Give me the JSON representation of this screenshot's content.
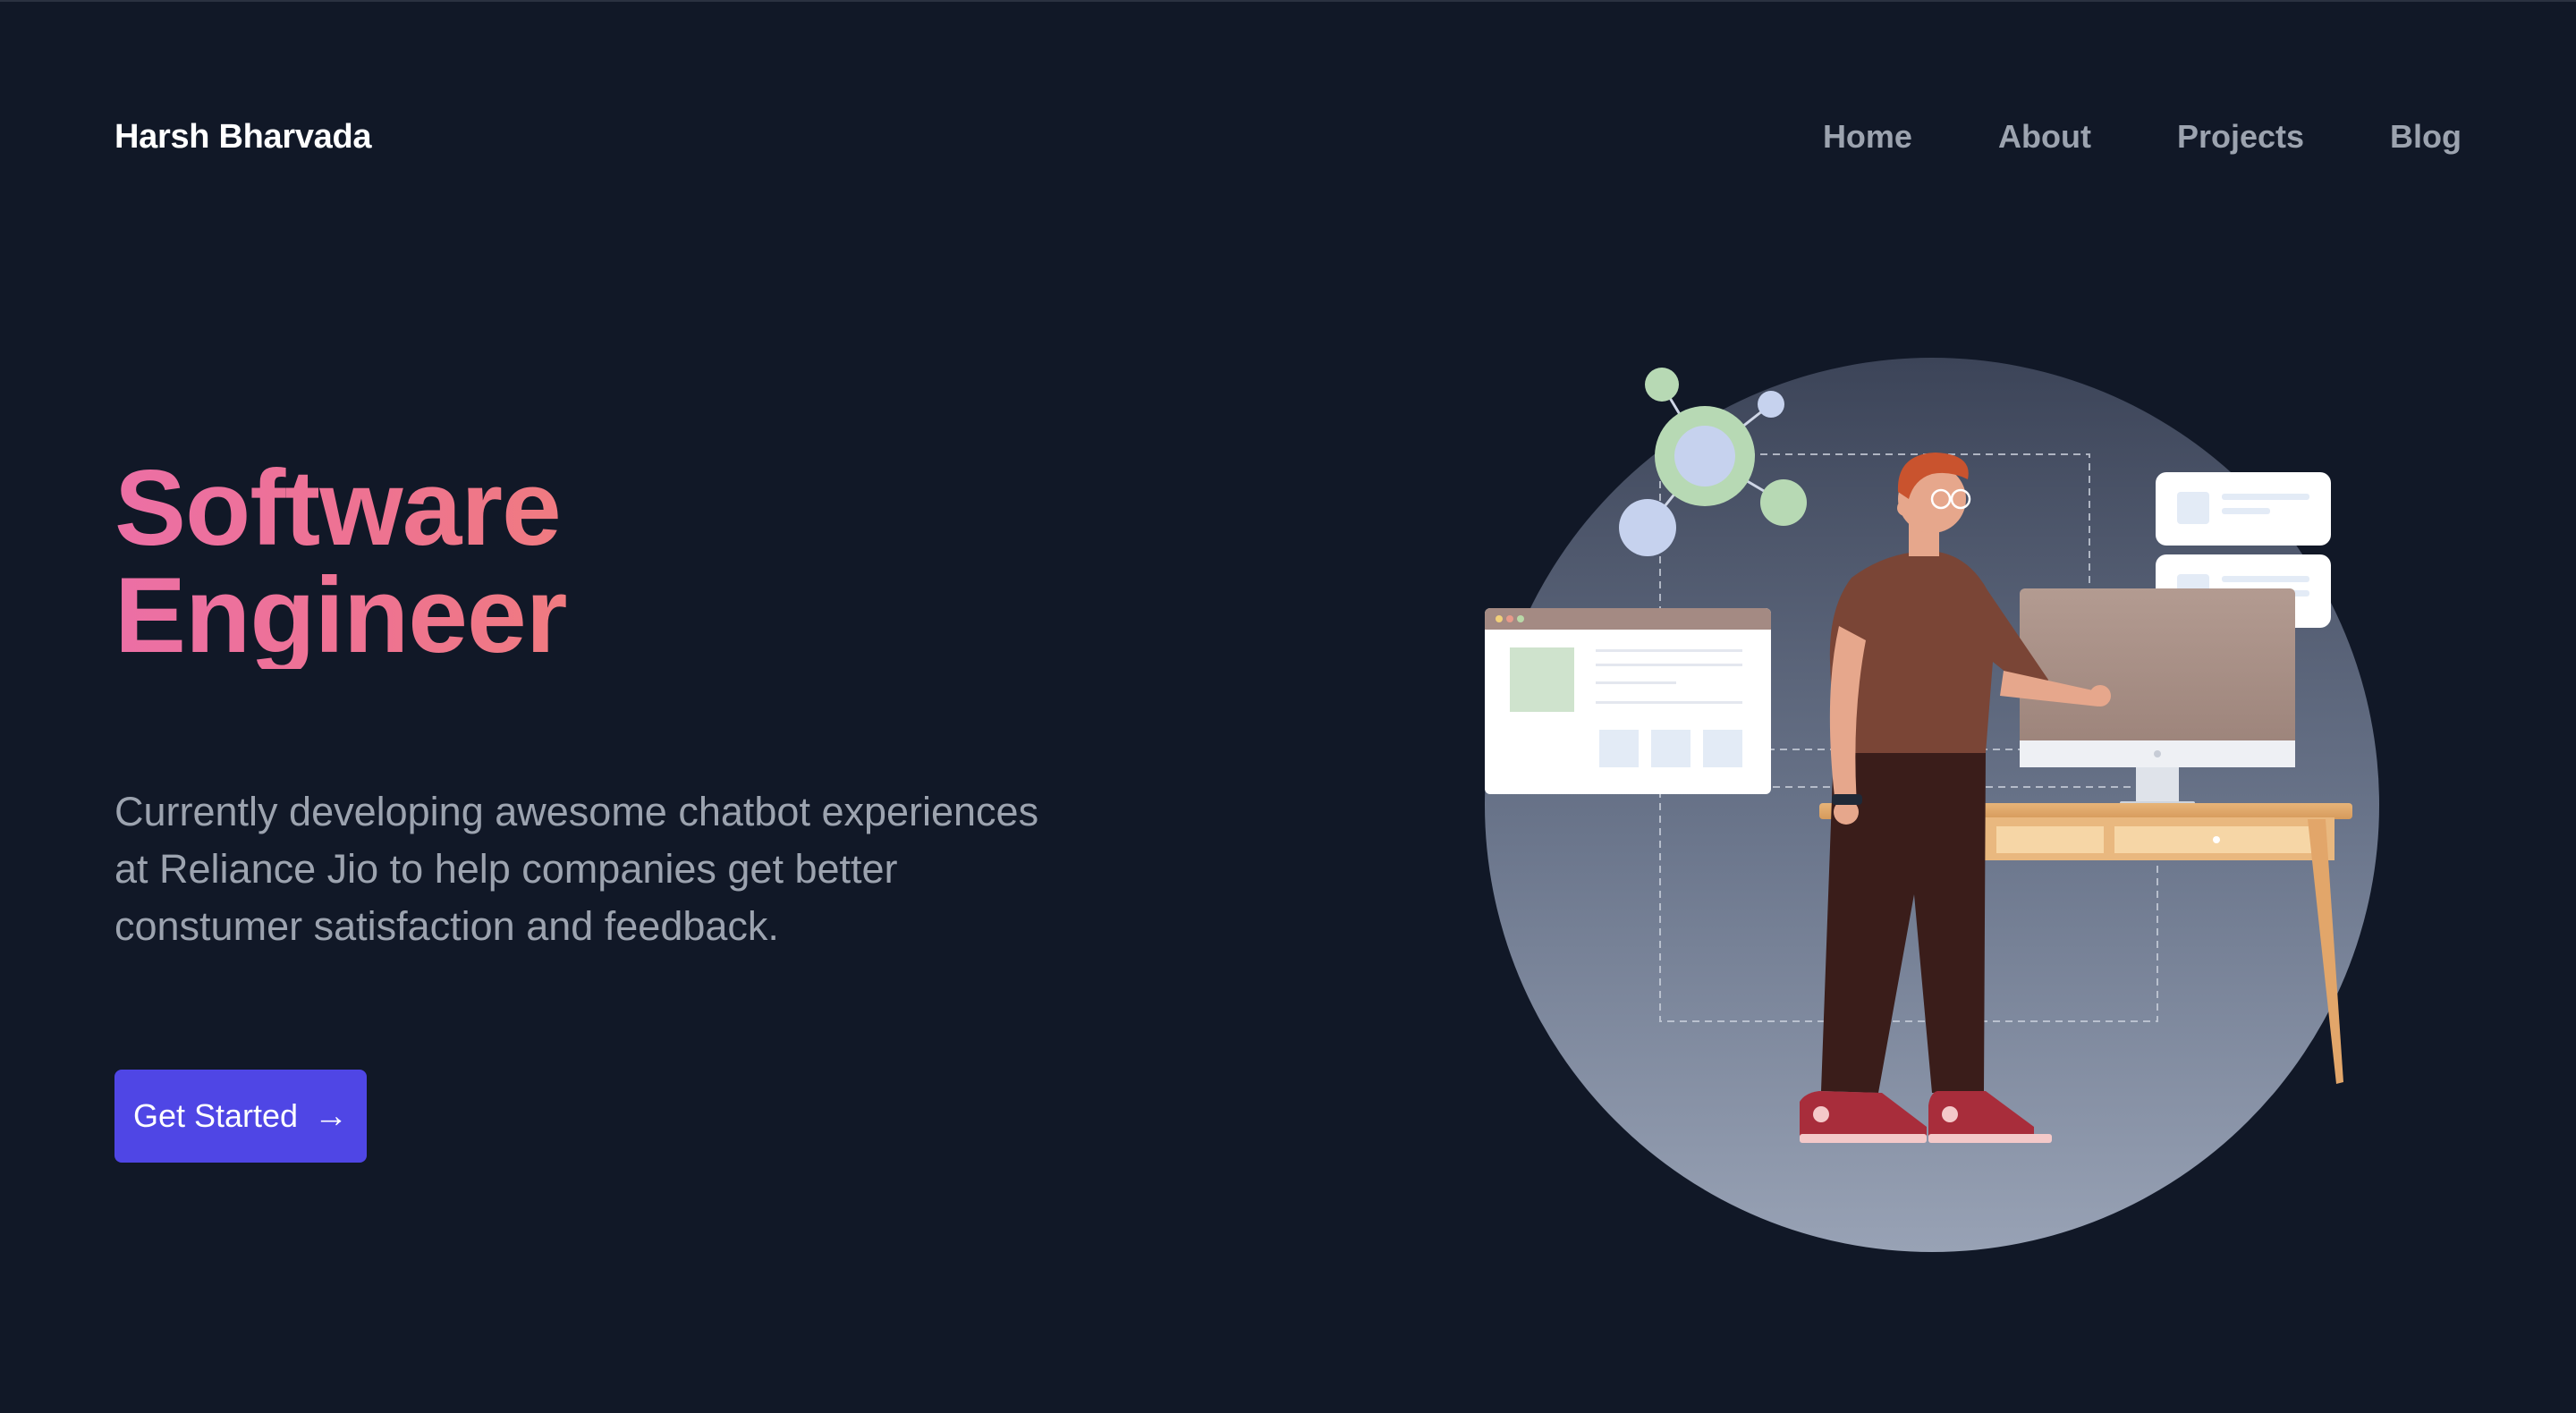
{
  "header": {
    "brand": "Harsh Bharvada",
    "nav": [
      {
        "label": "Home"
      },
      {
        "label": "About"
      },
      {
        "label": "Projects"
      },
      {
        "label": "Blog"
      }
    ]
  },
  "hero": {
    "title_line1": "Software",
    "title_line2": "Engineer",
    "description": "Currently developing awesome chatbot experiences at Reliance Jio to help companies get better constumer satisfaction and feedback.",
    "cta_label": "Get Started",
    "cta_icon": "arrow-right-icon"
  },
  "colors": {
    "background": "#111827",
    "title_gradient_start": "#ec6fa5",
    "title_gradient_end": "#f07b80",
    "nav_text": "#9ca3af",
    "cta": "#4f46e5"
  }
}
